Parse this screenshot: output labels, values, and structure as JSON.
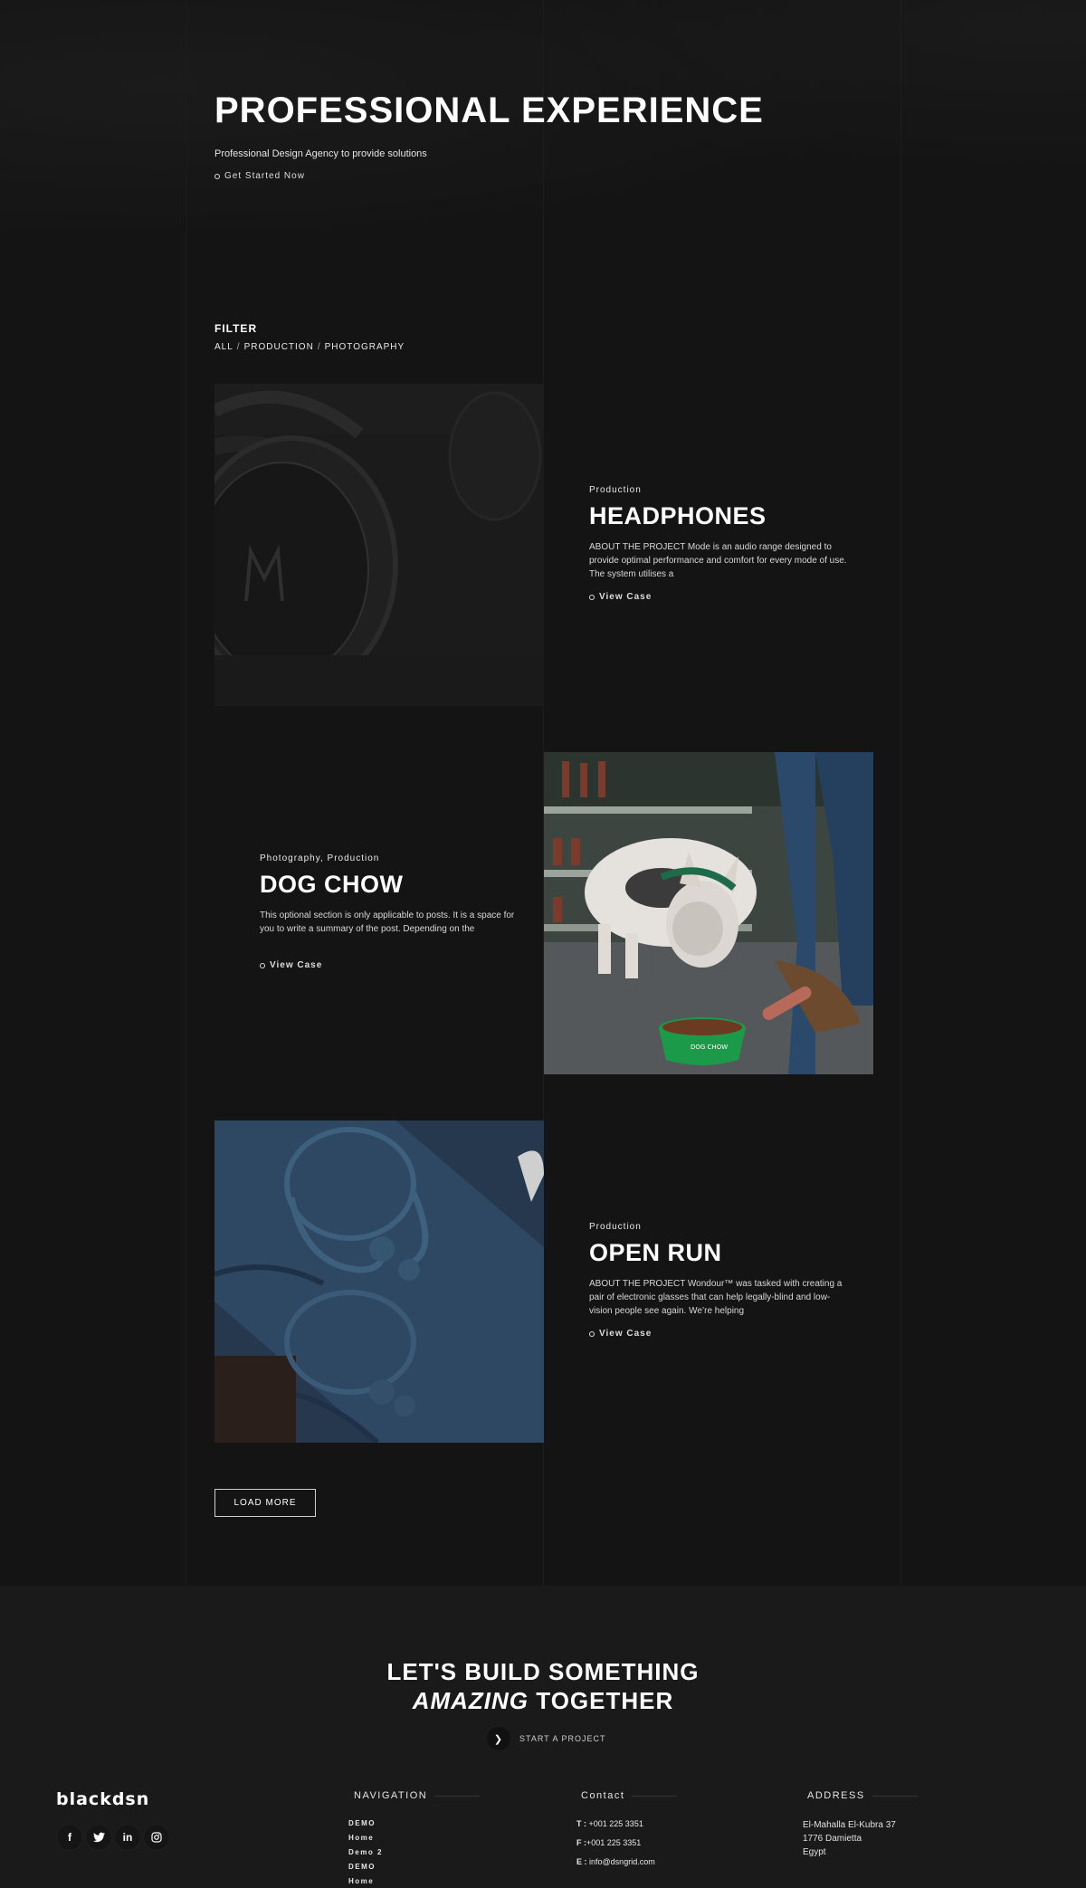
{
  "hero": {
    "title": "PROFESSIONAL EXPERIENCE",
    "subtitle": "Professional Design Agency to provide solutions",
    "cta": "Get Started Now"
  },
  "filter": {
    "title": "FILTER",
    "items": [
      "ALL",
      "PRODUCTION",
      "PHOTOGRAPHY"
    ],
    "separator": "/"
  },
  "projects": [
    {
      "category": "Production",
      "title": "HEADPHONES",
      "description": "ABOUT THE PROJECT Mode is an audio range designed to provide optimal performance and comfort for every mode of use. The system utilises a",
      "link": "View Case",
      "image_icon": "headphones-image"
    },
    {
      "category": "Photography, Production",
      "title": "DOG CHOW",
      "description": "This optional section is only applicable to posts. It is a space for you to write a summary of the post. Depending on the",
      "link": "View Case",
      "image_icon": "dog-image",
      "bowl_label": "DOG CHOW"
    },
    {
      "category": "Production",
      "title": "OPEN RUN",
      "description": "ABOUT THE PROJECT Wondour™ was tasked with creating a pair of electronic glasses that can help legally-blind and low-vision people see again. We’re helping",
      "link": "View Case",
      "image_icon": "bone-conduction-headphones-image"
    }
  ],
  "load_more": "LOAD MORE",
  "footer": {
    "cta_line1": "LET'S BUILD SOMETHING",
    "cta_emphasis": "AMAZING",
    "cta_line2_rest": "TOGETHER",
    "start_project": "START A PROJECT",
    "brand": "blackdsn",
    "socials": [
      "f",
      "t",
      "in",
      "ig"
    ],
    "navigation": {
      "title": "NAVIGATION",
      "items": [
        "DEMO",
        "Home",
        "Demo 2",
        "DEMO",
        "Home"
      ]
    },
    "contact": {
      "title": "Contact",
      "phone_label": "T :",
      "phone": "+001 225 3351",
      "fax_label": "F :",
      "fax": "+001 225 3351",
      "email_label": "E :",
      "email": "info@dsngrid.com"
    },
    "address": {
      "title": "ADDRESS",
      "line1": "El-Mahalla El-Kubra 37",
      "line2": "1776 Damietta",
      "line3": "Egypt"
    }
  },
  "colors": {
    "background": "#141414",
    "footer_background": "#1a1a1a",
    "text": "#ffffff",
    "bowl_green": "#1b9a4a"
  }
}
